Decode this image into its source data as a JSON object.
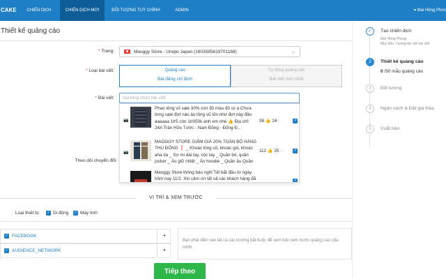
{
  "nav": {
    "logo": "CAKE",
    "tabs": [
      {
        "label": "CHIẾN DỊCH"
      },
      {
        "label": "CHIẾN DỊCH MỚI"
      },
      {
        "label": "ĐỐI TƯỢNG TUỲ CHỈNH"
      },
      {
        "label": "ADMIN"
      }
    ],
    "active_tab": "CHIẾN DỊCH MỚI",
    "user": "▾ Mai Hồng Phon"
  },
  "page_title": "Thiết kế quảng cáo",
  "form": {
    "page_label": "Trang:",
    "page_value": "Maoggy Store - Uniqlo Japan (1603585619701188)",
    "post_type_label": "Loại bài viết:",
    "post_type_options": [
      {
        "line1": "Quảng cáo",
        "line2": "Bài đăng chỉ định"
      },
      {
        "line1": "Tự động quảng cáo",
        "line2": "Bài viết mới nhất"
      }
    ],
    "post_label": "Bài viết:",
    "post_placeholder": "Vui lòng chọn bài viết",
    "follow_label": "Theo dõi chuyển đổi:"
  },
  "posts": [
    {
      "text": "Phao lông vũ sale 30% còn đủ màu đủ sz ạ Chưa từng sale đợt nào áo lông vũ tốn như đợt này đâu aaaaaa 1tr5 còn 1tr050k anh em nhé 👍 Địa chỉ: 24A Trần Hữu Tước - Nam Đồng - Đống Đ...",
      "stat1": "38",
      "stat2": "24"
    },
    {
      "text": "MAOGGY STORE GIẢM GIÁ 20% TOÀN BỘ HÀNG THU ĐÔNG ❗ _ Khoác lông vũ, khoác gió, khoác aha da _ Sơ mi dài tay, cộc tay _ Quần bò, quần jocker _ Áo giữ nhiệt _ Áo hoodie _ Quần âu Quần âu...",
      "stat1": "112",
      "stat2": "25"
    },
    {
      "text": "Maoggy Store thông báo nghỉ Tết bắt đầu từ ngày hôm nay 11/2. Xin cảm ơn tất cả các khách hàng đã",
      "stat1": "",
      "stat2": ""
    }
  ],
  "section": {
    "title": "VỊ TRÍ & XEM TRƯỚC"
  },
  "devices": {
    "label": "Loại thiết bị:",
    "mobile": "Di động",
    "desktop": "Máy tính"
  },
  "placements": [
    {
      "name": "FACEBOOK"
    },
    {
      "name": "AUDIENCE_NETWORK"
    }
  ],
  "preview_text": "Bạn phải điền vào tất cả các trường bắt buộc để xem bản xem trước quảng cáo của mình.",
  "next_button": "Tiếp theo",
  "steps": [
    {
      "num": "✓",
      "title": "Tạo chiến dịch",
      "sub1": "Mai Hồng Phong",
      "sub2": "Mục tiêu: Tương tác với bài viết"
    },
    {
      "num": "2",
      "title": "Thiết kế quảng cáo",
      "count_value": "0",
      "count_text": "/50 mẫu quảng cáo"
    },
    {
      "num": "3",
      "title": "Đối tượng"
    },
    {
      "num": "4",
      "title": "Ngân sách & Đặt giá thầu"
    },
    {
      "num": "5",
      "title": "Xuất bản"
    }
  ],
  "colors": {
    "primary": "#1f7fc6",
    "nav_active": "#0f5d98",
    "success": "#2eb84a"
  }
}
